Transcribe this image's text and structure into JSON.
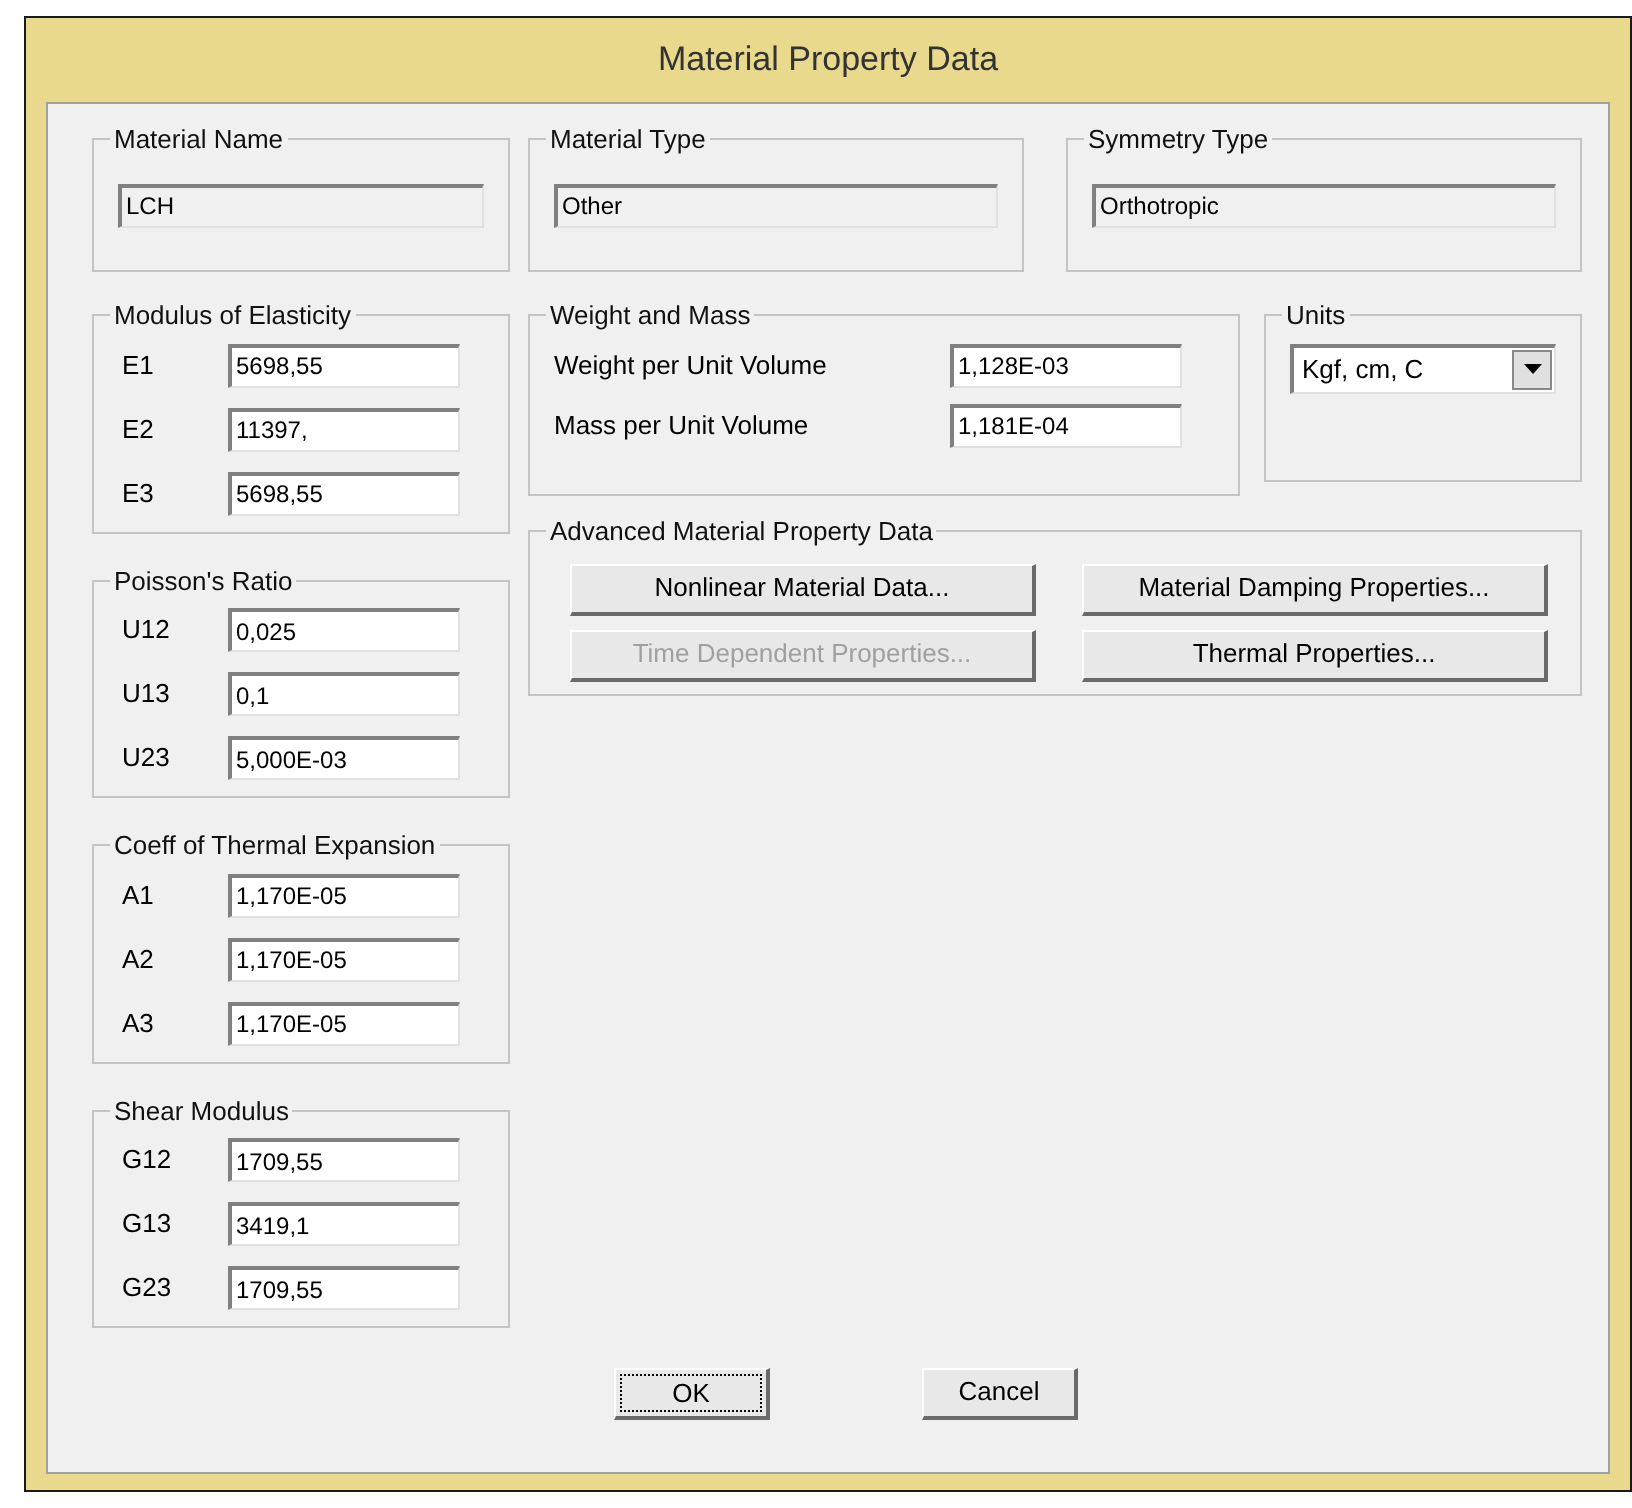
{
  "window": {
    "title": "Material Property Data"
  },
  "top_groups": [
    {
      "title": "Material Name",
      "value": "LCH",
      "readonly": true
    },
    {
      "title": "Material Type",
      "value": "Other",
      "readonly": true
    },
    {
      "title": "Symmetry Type",
      "value": "Orthotropic",
      "readonly": true
    }
  ],
  "left_groups": [
    {
      "title": "Modulus of Elasticity",
      "fields": [
        {
          "label": "E1",
          "value": "5698,55"
        },
        {
          "label": "E2",
          "value": "11397,"
        },
        {
          "label": "E3",
          "value": "5698,55"
        }
      ]
    },
    {
      "title": "Poisson's Ratio",
      "fields": [
        {
          "label": "U12",
          "value": "0,025"
        },
        {
          "label": "U13",
          "value": "0,1"
        },
        {
          "label": "U23",
          "value": "5,000E-03"
        }
      ]
    },
    {
      "title": "Coeff of Thermal Expansion",
      "fields": [
        {
          "label": "A1",
          "value": "1,170E-05"
        },
        {
          "label": "A2",
          "value": "1,170E-05"
        },
        {
          "label": "A3",
          "value": "1,170E-05"
        }
      ]
    },
    {
      "title": "Shear Modulus",
      "fields": [
        {
          "label": "G12",
          "value": "1709,55"
        },
        {
          "label": "G13",
          "value": "3419,1"
        },
        {
          "label": "G23",
          "value": "1709,55"
        }
      ]
    }
  ],
  "weight_and_mass": {
    "title": "Weight and Mass",
    "fields": [
      {
        "label": "Weight per Unit Volume",
        "value": "1,128E-03"
      },
      {
        "label": "Mass per Unit Volume",
        "value": "1,181E-04"
      }
    ]
  },
  "units": {
    "title": "Units",
    "value": "Kgf, cm, C"
  },
  "advanced": {
    "title": "Advanced Material Property Data",
    "buttons": [
      {
        "label": "Nonlinear Material Data...",
        "disabled": false
      },
      {
        "label": "Material Damping Properties...",
        "disabled": false
      },
      {
        "label": "Time Dependent Properties...",
        "disabled": true
      },
      {
        "label": "Thermal Properties...",
        "disabled": false
      }
    ]
  },
  "dialog_buttons": [
    {
      "label": "OK",
      "focused": true
    },
    {
      "label": "Cancel",
      "focused": false
    }
  ]
}
